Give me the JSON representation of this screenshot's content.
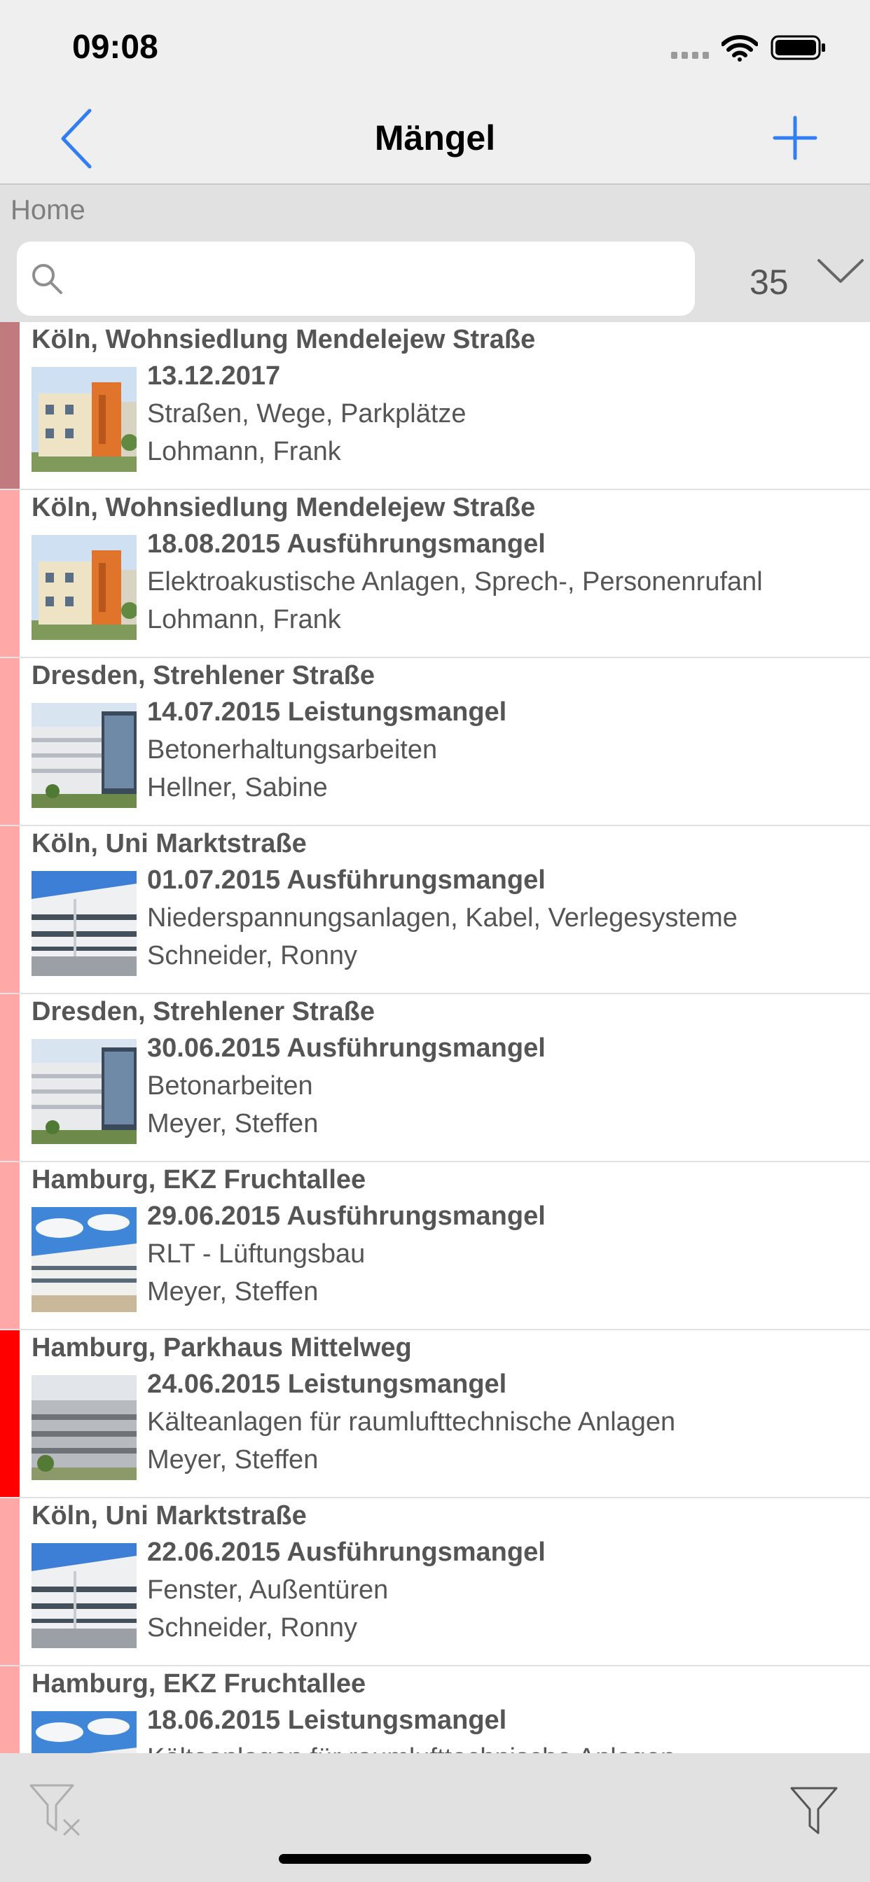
{
  "status_bar": {
    "time": "09:08"
  },
  "navbar": {
    "title": "Mängel",
    "icons": {
      "back": "chevron-left-icon",
      "add": "plus-icon"
    }
  },
  "breadcrumb": "Home",
  "search": {
    "placeholder": "",
    "count": "35",
    "icons": {
      "search": "search-icon",
      "sort": "chevron-down-icon"
    }
  },
  "colors": {
    "accent": "#2f7ff2",
    "priority_dark": "#c17a7e",
    "priority_light": "#ffa8a8",
    "priority_red": "#ff0000"
  },
  "items": [
    {
      "location": "Köln, Wohnsiedlung Mendelejew Straße",
      "date_type": "13.12.2017",
      "trade": "Straßen, Wege, Parkplätze",
      "person": "Lohmann, Frank",
      "priority_color": "#c17a7e",
      "image": "building-orange-photo"
    },
    {
      "location": "Köln, Wohnsiedlung Mendelejew Straße",
      "date_type": "18.08.2015 Ausführungsmangel",
      "trade": "Elektroakustische Anlagen, Sprech-, Personenrufanl",
      "person": "Lohmann, Frank",
      "priority_color": "#ffa8a8",
      "image": "building-orange-photo"
    },
    {
      "location": "Dresden, Strehlener Straße",
      "date_type": "14.07.2015 Leistungsmangel",
      "trade": "Betonerhaltungsarbeiten",
      "person": "Hellner, Sabine",
      "priority_color": "#ffa8a8",
      "image": "office-glass-photo"
    },
    {
      "location": "Köln, Uni Marktstraße",
      "date_type": "01.07.2015 Ausführungsmangel",
      "trade": "Niederspannungsanlagen, Kabel, Verlegesysteme",
      "person": "Schneider, Ronny",
      "priority_color": "#ffa8a8",
      "image": "office-white-photo"
    },
    {
      "location": "Dresden, Strehlener Straße",
      "date_type": "30.06.2015 Ausführungsmangel",
      "trade": "Betonarbeiten",
      "person": "Meyer, Steffen",
      "priority_color": "#ffa8a8",
      "image": "office-glass-photo"
    },
    {
      "location": "Hamburg, EKZ Fruchtallee",
      "date_type": "29.06.2015 Ausführungsmangel",
      "trade": "RLT - Lüftungsbau",
      "person": "Meyer, Steffen",
      "priority_color": "#ffa8a8",
      "image": "mall-sky-photo"
    },
    {
      "location": "Hamburg, Parkhaus Mittelweg",
      "date_type": "24.06.2015 Leistungsmangel",
      "trade": "Kälteanlagen für raumlufttechnische Anlagen",
      "person": "Meyer, Steffen",
      "priority_color": "#ff0000",
      "image": "parking-garage-photo"
    },
    {
      "location": "Köln, Uni Marktstraße",
      "date_type": "22.06.2015 Ausführungsmangel",
      "trade": "Fenster, Außentüren",
      "person": "Schneider, Ronny",
      "priority_color": "#ffa8a8",
      "image": "office-white-photo"
    },
    {
      "location": "Hamburg, EKZ Fruchtallee",
      "date_type": "18.06.2015 Leistungsmangel",
      "trade": "Kälteanlagen für raumlufttechnische Anlagen",
      "person": "",
      "priority_color": "#ffa8a8",
      "image": "mall-sky-photo"
    }
  ],
  "bottom_bar": {
    "icons": {
      "clear_filter": "filter-clear-icon",
      "filter": "filter-icon"
    }
  }
}
